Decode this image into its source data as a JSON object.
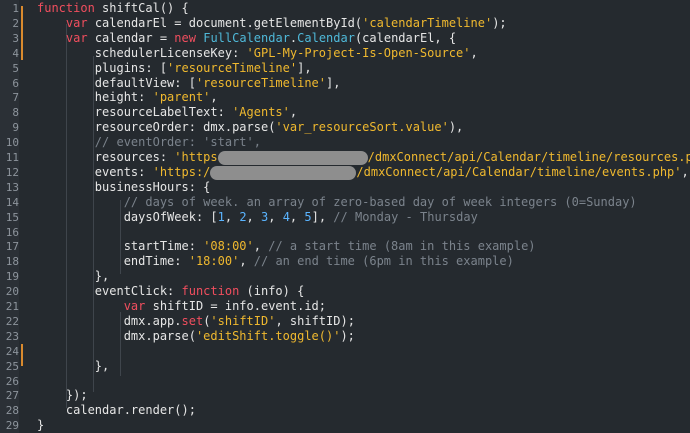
{
  "editor": {
    "line_numbers": [
      "1",
      "2",
      "3",
      "4",
      "5",
      "6",
      "7",
      "8",
      "9",
      "10",
      "11",
      "12",
      "13",
      "14",
      "15",
      "16",
      "17",
      "18",
      "19",
      "20",
      "21",
      "22",
      "23",
      "24",
      "25",
      "26",
      "27",
      "28",
      "29"
    ],
    "accent_marker_color": "#d98a2e",
    "colors": {
      "keyword": "#f04e5e",
      "string": "#f0b92f",
      "number": "#5ab4ff",
      "class": "#4fb9d9",
      "comment": "#7b838c",
      "text": "#e6e6e6"
    }
  },
  "code": {
    "l1": {
      "kw": "function",
      "name": " shiftCal() {"
    },
    "l2": {
      "indent": "    ",
      "kw": "var",
      "a": " calendarEl = document.getElementById(",
      "s": "'calendarTimeline'",
      "b": ");"
    },
    "l3": {
      "indent": "    ",
      "kw": "var",
      "a": " calendar = ",
      "kw2": "new",
      "sp": " ",
      "cls1": "FullCalendar",
      "dot": ".",
      "cls2": "Calendar",
      "b": "(calendarEl, {"
    },
    "l4": {
      "indent": "        ",
      "a": "schedulerLicenseKey: ",
      "s": "'GPL-My-Project-Is-Open-Source'",
      "b": ","
    },
    "l5": {
      "indent": "        ",
      "a": "plugins: [",
      "s": "'resourceTimeline'",
      "b": "],"
    },
    "l6": {
      "indent": "        ",
      "a": "defaultView: [",
      "s": "'resourceTimeline'",
      "b": "],"
    },
    "l7": {
      "indent": "        ",
      "a": "height: ",
      "s": "'parent'",
      "b": ","
    },
    "l8": {
      "indent": "        ",
      "a": "resourceLabelText: ",
      "s": "'Agents'",
      "b": ","
    },
    "l9": {
      "indent": "        ",
      "a": "resourceOrder: dmx.parse(",
      "s": "'var_resourceSort.value'",
      "b": "),"
    },
    "l10": {
      "indent": "        ",
      "c": "// eventOrder: 'start',"
    },
    "l11": {
      "indent": "        ",
      "a": "resources: ",
      "s1": "'https",
      "s2": "/dmxConnect/api/Calendar/timeline/resources.php'",
      "b": ","
    },
    "l12": {
      "indent": "        ",
      "a": "events: ",
      "s1": "'https:/",
      "s2": "/dmxConnect/api/Calendar/timeline/events.php'",
      "b": ","
    },
    "l13": {
      "indent": "        ",
      "a": "businessHours: {"
    },
    "l14": {
      "indent": "            ",
      "c": "// days of week. an array of zero-based day of week integers (0=Sunday)"
    },
    "l15": {
      "indent": "            ",
      "a": "daysOfWeek: [",
      "n1": "1",
      "n2": "2",
      "n3": "3",
      "n4": "4",
      "n5": "5",
      "b": "], ",
      "c": "// Monday - Thursday"
    },
    "l16": {
      "text": ""
    },
    "l17": {
      "indent": "            ",
      "a": "startTime: ",
      "s": "'08:00'",
      "b": ", ",
      "c": "// a start time (8am in this example)"
    },
    "l18": {
      "indent": "            ",
      "a": "endTime: ",
      "s": "'18:00'",
      "b": ", ",
      "c": "// an end time (6pm in this example)"
    },
    "l19": {
      "indent": "        ",
      "a": "},"
    },
    "l20": {
      "indent": "        ",
      "a": "eventClick: ",
      "kw": "function",
      "b": " (info) {"
    },
    "l21": {
      "indent": "            ",
      "kw": "var",
      "a": " shiftID = info.event.id;"
    },
    "l22": {
      "indent": "            ",
      "a": "dmx.app.",
      "fn": "set",
      "b": "(",
      "s": "'shiftID'",
      "c2": ", shiftID);"
    },
    "l23": {
      "indent": "            ",
      "a": "dmx.parse(",
      "s": "'editShift.toggle()'",
      "b": ");"
    },
    "l24": {
      "text": ""
    },
    "l25": {
      "indent": "        ",
      "a": "},"
    },
    "l26": {
      "text": ""
    },
    "l27": {
      "indent": "    ",
      "a": "});"
    },
    "l28": {
      "indent": "    ",
      "a": "calendar.render();"
    },
    "l29": {
      "a": "}"
    }
  }
}
